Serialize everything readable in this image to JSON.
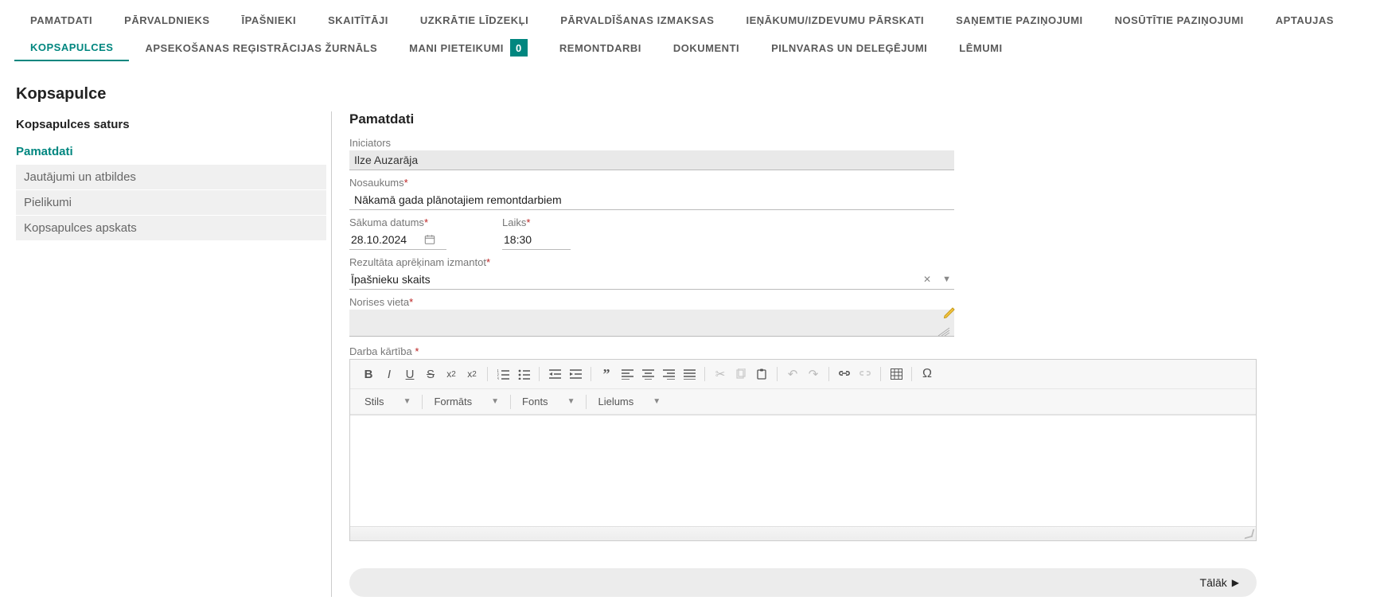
{
  "tabs": {
    "pamatdati": "PAMATDATI",
    "parvaldnieks": "PĀRVALDNIEKS",
    "ipasnieki": "ĪPAŠNIEKI",
    "skaititaji": "SKAITĪTĀJI",
    "uzkratie": "UZKRĀTIE LĪDZEKĻI",
    "parvaldisanas": "PĀRVALDĪŠANAS IZMAKSAS",
    "ienakumu": "IEŅĀKUMU/IZDEVUMU PĀRSKATI",
    "sanemtie": "SAŅEMTIE PAZIŅOJUMI",
    "nosutitie": "NOSŪTĪTIE PAZIŅOJUMI",
    "aptaujas": "APTAUJAS",
    "kopsapulces": "KOPSAPULCES",
    "apsekosanas": "APSEKOŠANAS REĢISTRĀCIJAS ŽURNĀLS",
    "mani_pieteikumi": "MANI PIETEIKUMI",
    "mani_pieteikumi_badge": "0",
    "remontdarbi": "REMONTDARBI",
    "dokumenti": "DOKUMENTI",
    "pilnvaras": "PILNVARAS UN DELEĢĒJUMI",
    "lemumi": "LĒMUMI"
  },
  "page": {
    "title": "Kopsapulce"
  },
  "sidebar": {
    "title": "Kopsapulces saturs",
    "items": {
      "pamatdati": "Pamatdati",
      "jautajumi": "Jautājumi un atbildes",
      "pielikumi": "Pielikumi",
      "apskats": "Kopsapulces apskats"
    }
  },
  "panel": {
    "title": "Pamatdati"
  },
  "labels": {
    "iniciators": "Iniciators",
    "nosaukums": "Nosaukums",
    "sakuma_datums": "Sākuma datums",
    "laiks": "Laiks",
    "rezultata": "Rezultāta aprēķinam izmantot",
    "norises_vieta": "Norises vieta",
    "darba_kartiba": "Darba kārtība "
  },
  "values": {
    "iniciators": "Ilze Auzarāja",
    "nosaukums": "Nākamā gada plānotajiem remontdarbiem",
    "sakuma_datums": "28.10.2024",
    "laiks": "18:30",
    "rezultata": "Īpašnieku skaits",
    "norises_vieta": ""
  },
  "rte": {
    "combo_stils": "Stils",
    "combo_formats": "Formāts",
    "combo_fonts": "Fonts",
    "combo_lielums": "Lielums"
  },
  "buttons": {
    "next": "Tālāk"
  }
}
